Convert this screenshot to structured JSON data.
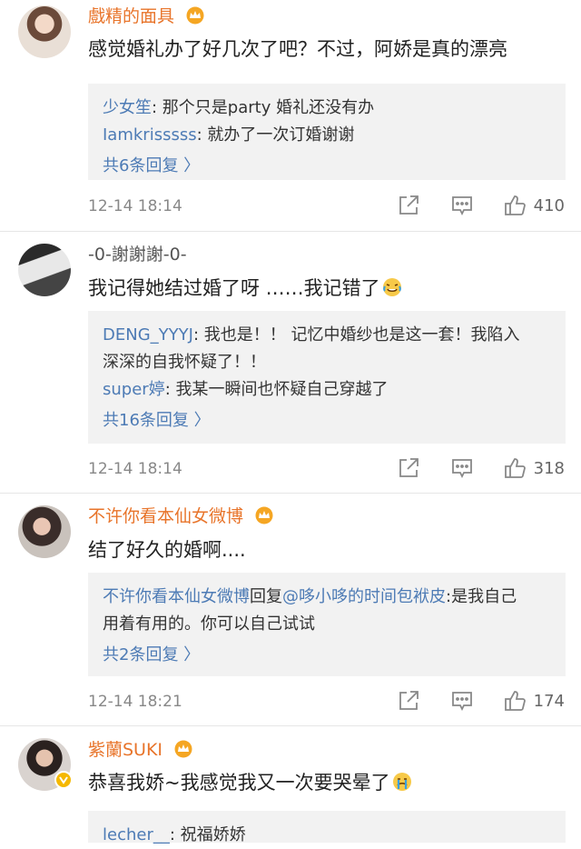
{
  "comments": [
    {
      "username": "戲精的面具",
      "content": "感觉婚礼办了好几次了吧？不过，阿娇是真的漂亮",
      "replies": [
        {
          "name": "少女笙",
          "text": ": 那个只是party 婚礼还没有办"
        },
        {
          "name": "Iamkrisssss",
          "text": ": 就办了一次订婚谢谢"
        }
      ],
      "more": "共6条回复 〉",
      "time": "12-14 18:14",
      "likes": "410"
    },
    {
      "username": "-0-謝謝謝-0-",
      "content": "我记得她结过婚了呀 ……我记错了",
      "replies": [
        {
          "name": "DENG_YYYJ",
          "text": ": 我也是！！ 记忆中婚纱也是这一套！我陷入"
        },
        {
          "name": "",
          "text": "深深的自我怀疑了！！"
        },
        {
          "name": "super婷",
          "text": ": 我某一瞬间也怀疑自己穿越了"
        }
      ],
      "more": "共16条回复 〉",
      "time": "12-14 18:14",
      "likes": "318"
    },
    {
      "username": "不许你看本仙女微博",
      "content": "结了好久的婚啊....",
      "replies": [
        {
          "name": "不许你看本仙女微博",
          "text": "回复",
          "extra": "@哆小哆的时间包袱皮",
          "tail": ":是我自己"
        },
        {
          "name": "",
          "text": "用着有用的。你可以自己试试"
        }
      ],
      "more": "共2条回复 〉",
      "time": "12-14 18:21",
      "likes": "174"
    },
    {
      "username": "紫蘭SUKI",
      "content": "恭喜我娇~我感觉我又一次要哭晕了",
      "replies": [
        {
          "name": "lecher__",
          "text": ": 祝福娇娇"
        }
      ]
    }
  ],
  "colors": {
    "accent": "#e8742a",
    "link": "#4d7bb5",
    "reply_bg": "#f2f2f2"
  }
}
